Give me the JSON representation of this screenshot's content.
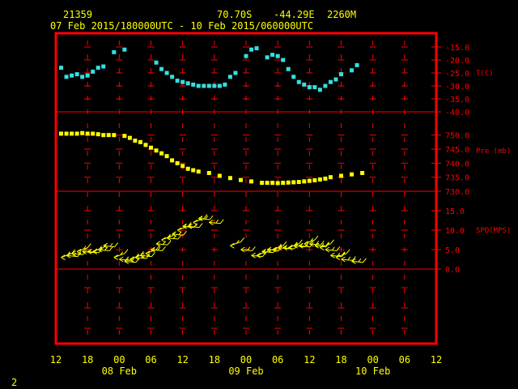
{
  "header": {
    "station_id": "21359",
    "lat": "70.70S",
    "lon": "-44.29E",
    "elevation": "2260M",
    "time_range": "07 Feb 2015/180000UTC - 10 Feb 2015/060000UTC"
  },
  "footer": {
    "page_number": "2"
  },
  "colors": {
    "frame": "#ff0000",
    "temp": "#33e0e0",
    "pressure": "#ffff00",
    "wind": "#ffff00",
    "text": "#ffff00",
    "axis": "#ff0000"
  },
  "chart_data": [
    {
      "type": "scatter",
      "title": "",
      "ylabel": "T(C)",
      "ylim": [
        -40,
        -15
      ],
      "yticks": [
        "-15.0",
        "-20.0",
        "-25.0",
        "-30.0",
        "-35.0",
        "-40.0"
      ],
      "x_ticks": [
        "12",
        "18",
        "00",
        "06",
        "12",
        "18",
        "00",
        "06",
        "12",
        "18",
        "00",
        "06",
        "12"
      ],
      "x_day_labels": [
        "08 Feb",
        "09 Feb",
        "10 Feb"
      ],
      "x_unit": "hours since 07 Feb 2015 12 UTC",
      "x_range": [
        0,
        72
      ],
      "x": [
        1,
        2,
        3,
        4,
        5,
        6,
        7,
        8,
        9,
        11,
        13,
        19,
        20,
        21,
        22,
        23,
        24,
        25,
        26,
        27,
        28,
        29,
        30,
        31,
        32,
        33,
        34,
        36,
        37,
        38,
        40,
        41,
        42,
        43,
        44,
        45,
        46,
        47,
        48,
        49,
        50,
        51,
        52,
        53,
        54,
        56,
        57
      ],
      "values": [
        -23,
        -26.5,
        -26,
        -25.5,
        -26.5,
        -26,
        -24.5,
        -23,
        -22.5,
        -17,
        -16,
        -21,
        -23.5,
        -25,
        -26.5,
        -28,
        -28.5,
        -29,
        -29.5,
        -30,
        -30,
        -30,
        -30,
        -30,
        -29.5,
        -26.5,
        -25,
        -18.5,
        -16,
        -15.5,
        -19,
        -18,
        -18.5,
        -20,
        -23.5,
        -26.5,
        -28.5,
        -29.5,
        -30.5,
        -30.5,
        -31.5,
        -30,
        -28.5,
        -27.5,
        -25.5,
        -24,
        -22
      ]
    },
    {
      "type": "scatter",
      "title": "",
      "ylabel": "Pre (mb)",
      "ylim": [
        730,
        752.5
      ],
      "yticks": [
        "750.0",
        "745.0",
        "740.0",
        "735.0",
        "730.0"
      ],
      "x": [
        1,
        2,
        3,
        4,
        5,
        6,
        7,
        8,
        9,
        10,
        11,
        13,
        14,
        15,
        16,
        17,
        18,
        19,
        20,
        21,
        22,
        23,
        24,
        25,
        26,
        27,
        29,
        31,
        33,
        35,
        37,
        39,
        40,
        41,
        42,
        43,
        44,
        45,
        46,
        47,
        48,
        49,
        50,
        51,
        52,
        54,
        56,
        58
      ],
      "values": [
        750.5,
        750.5,
        750.5,
        750.5,
        750.7,
        750.5,
        750.5,
        750.3,
        750,
        750,
        750,
        749.7,
        749,
        748,
        747.5,
        746.5,
        745.5,
        744.5,
        743.5,
        742.5,
        741,
        740,
        739,
        738,
        737.5,
        737,
        736.5,
        735.5,
        734.7,
        734,
        733.5,
        733,
        733,
        733,
        732.9,
        733,
        733.1,
        733.2,
        733.3,
        733.5,
        733.7,
        733.9,
        734.2,
        734.5,
        735,
        735.5,
        736,
        736.5
      ]
    },
    {
      "type": "scatter",
      "title": "",
      "ylabel": "SPD(MPS)",
      "ylim": [
        0,
        15
      ],
      "yticks": [
        "15.0",
        "10.0",
        "5.0",
        "0.0"
      ],
      "x": [
        1,
        2,
        3,
        4,
        5,
        6,
        7,
        8,
        9,
        11,
        12,
        13,
        14,
        15,
        16,
        17,
        18,
        19,
        20,
        21,
        22,
        23,
        24,
        25,
        26,
        27,
        29,
        33,
        35,
        37,
        38,
        39,
        40,
        41,
        42,
        43,
        44,
        45,
        46,
        47,
        48,
        49,
        50,
        51,
        52,
        53,
        54,
        56
      ],
      "values": [
        3,
        3.5,
        4,
        4.5,
        4.5,
        4.5,
        4.5,
        5,
        6,
        3,
        2.5,
        2,
        2.5,
        3,
        3.5,
        4,
        5,
        6.5,
        7.5,
        8,
        9,
        10,
        11,
        11,
        12,
        13,
        12,
        6,
        5,
        3.5,
        3.5,
        4.5,
        5,
        5,
        5.5,
        5.5,
        5.5,
        6,
        6,
        6.5,
        6.5,
        6,
        5.5,
        5,
        3.5,
        3,
        2.5,
        2
      ]
    }
  ]
}
